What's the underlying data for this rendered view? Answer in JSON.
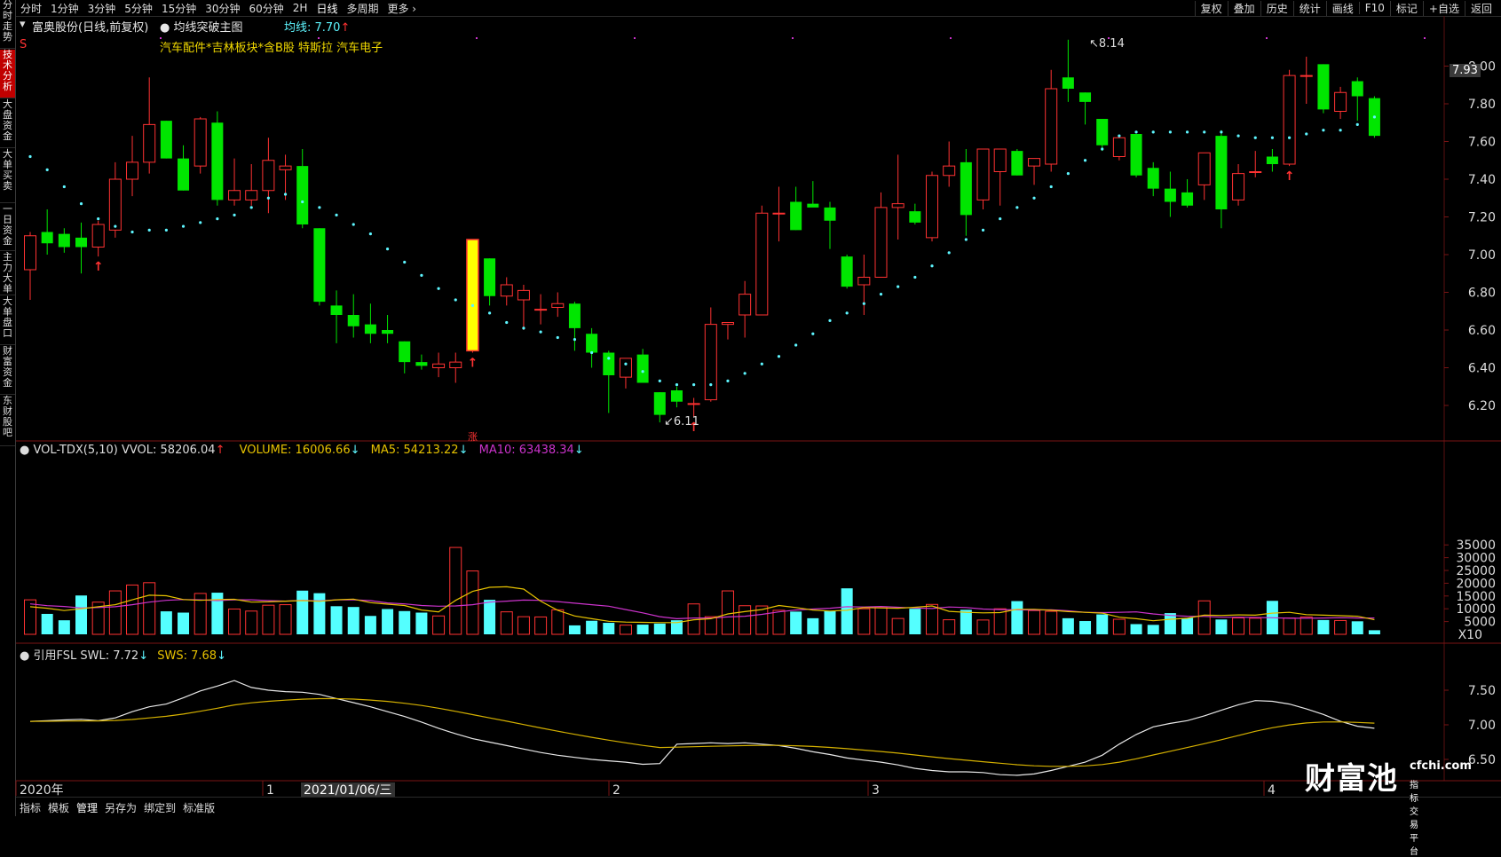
{
  "topbar": {
    "periods": [
      "分时",
      "1分钟",
      "3分钟",
      "5分钟",
      "15分钟",
      "30分钟",
      "60分钟",
      "2H",
      "日线",
      "多周期",
      "更多"
    ],
    "active": "日线",
    "right_tools": [
      "复权",
      "叠加",
      "历史",
      "统计",
      "画线",
      "F10",
      "标记",
      "+自选",
      "返回"
    ]
  },
  "sidebar": [
    {
      "label": "分时走势",
      "active": false
    },
    {
      "label": "技术分析",
      "active": true
    },
    {
      "label": "大盘资金",
      "active": false
    },
    {
      "label": "大单买卖",
      "active": false
    },
    {
      "label": "一日资金",
      "active": false
    },
    {
      "label": "主力大单",
      "active": false
    },
    {
      "label": "大单盘口",
      "active": false
    },
    {
      "label": "财富资金",
      "active": false
    },
    {
      "label": "东财股吧",
      "active": false
    }
  ],
  "header": {
    "stock": "富奥股份(日线,前复权)",
    "template": "均线突破主图",
    "ma_label": "均线: 7.70",
    "ma_arrow": "↑",
    "sectors": "汽车配件*吉林板块*含B股 特斯拉 汽车电子",
    "s_mark": "S"
  },
  "price_panel": {
    "axis_labels": [
      "8.00",
      "7.80",
      "7.60",
      "7.40",
      "7.20",
      "7.00",
      "6.80",
      "6.60",
      "6.40",
      "6.20"
    ],
    "axis_values": [
      8.0,
      7.8,
      7.6,
      7.4,
      7.2,
      7.0,
      6.8,
      6.6,
      6.4,
      6.2
    ],
    "current_price": "7.93",
    "high_note": "8.14",
    "low_note": "6.11",
    "zhang_mark": "涨"
  },
  "volume_panel": {
    "title": "VOL-TDX(5,10)",
    "vvol": "VVOL: 58206.04",
    "volume": "VOLUME: 16006.66",
    "ma5": "MA5: 54213.22",
    "ma10": "MA10: 63438.34",
    "axis_labels": [
      "35000",
      "30000",
      "25000",
      "20000",
      "15000",
      "10000",
      "5000",
      "X10"
    ],
    "axis_values": [
      35000,
      30000,
      25000,
      20000,
      15000,
      10000,
      5000
    ]
  },
  "fsl_panel": {
    "title": "引用FSL",
    "swl": "SWL: 7.72",
    "sws": "SWS: 7.68",
    "axis_labels": [
      "7.50",
      "7.00",
      "6.50"
    ],
    "axis_values": [
      7.5,
      7.0,
      6.5
    ]
  },
  "date_axis": {
    "labels": [
      "2020年",
      "1",
      "2021/01/06/三",
      "2",
      "3",
      "4"
    ]
  },
  "bottombar": {
    "items": [
      "指标",
      "模板",
      "管理",
      "另存为",
      "绑定到",
      "标准版"
    ],
    "active": "管理"
  },
  "watermark": {
    "brand": "财富池",
    "domain": "cfchi.com",
    "slogan": "指标交易平台"
  },
  "colors": {
    "up": "#ff3232",
    "down": "#00e600",
    "vol_down": "#54ffff",
    "ma_dots": "#5ef6ff",
    "ma5": "#e6c200",
    "ma10": "#cc33cc",
    "swl": "#e8e8e8",
    "sws": "#d4b000",
    "highlight": "#ffff00"
  },
  "chart_data": {
    "type": "candlestick",
    "candles": [
      {
        "o": 6.92,
        "h": 7.12,
        "l": 6.76,
        "c": 7.1
      },
      {
        "o": 7.12,
        "h": 7.24,
        "l": 7.0,
        "c": 7.06
      },
      {
        "o": 7.11,
        "h": 7.14,
        "l": 7.01,
        "c": 7.04
      },
      {
        "o": 7.09,
        "h": 7.17,
        "l": 6.9,
        "c": 7.04
      },
      {
        "o": 7.04,
        "h": 7.18,
        "l": 6.99,
        "c": 7.16
      },
      {
        "o": 7.13,
        "h": 7.49,
        "l": 7.09,
        "c": 7.4
      },
      {
        "o": 7.4,
        "h": 7.63,
        "l": 7.31,
        "c": 7.49
      },
      {
        "o": 7.49,
        "h": 7.94,
        "l": 7.43,
        "c": 7.69
      },
      {
        "o": 7.71,
        "h": 7.71,
        "l": 7.51,
        "c": 7.51
      },
      {
        "o": 7.51,
        "h": 7.58,
        "l": 7.34,
        "c": 7.34
      },
      {
        "o": 7.47,
        "h": 7.73,
        "l": 7.43,
        "c": 7.72
      },
      {
        "o": 7.7,
        "h": 7.76,
        "l": 7.26,
        "c": 7.29
      },
      {
        "o": 7.29,
        "h": 7.51,
        "l": 7.26,
        "c": 7.34
      },
      {
        "o": 7.29,
        "h": 7.48,
        "l": 7.26,
        "c": 7.34
      },
      {
        "o": 7.34,
        "h": 7.62,
        "l": 7.22,
        "c": 7.5
      },
      {
        "o": 7.45,
        "h": 7.53,
        "l": 7.29,
        "c": 7.47
      },
      {
        "o": 7.47,
        "h": 7.56,
        "l": 7.14,
        "c": 7.16
      },
      {
        "o": 7.14,
        "h": 7.14,
        "l": 6.73,
        "c": 6.75
      },
      {
        "o": 6.73,
        "h": 6.81,
        "l": 6.53,
        "c": 6.68
      },
      {
        "o": 6.68,
        "h": 6.79,
        "l": 6.56,
        "c": 6.62
      },
      {
        "o": 6.63,
        "h": 6.74,
        "l": 6.53,
        "c": 6.58
      },
      {
        "o": 6.6,
        "h": 6.68,
        "l": 6.53,
        "c": 6.58
      },
      {
        "o": 6.54,
        "h": 6.54,
        "l": 6.37,
        "c": 6.43
      },
      {
        "o": 6.43,
        "h": 6.47,
        "l": 6.39,
        "c": 6.41
      },
      {
        "o": 6.4,
        "h": 6.48,
        "l": 6.35,
        "c": 6.42
      },
      {
        "o": 6.4,
        "h": 6.48,
        "l": 6.32,
        "c": 6.43
      },
      {
        "o": 6.49,
        "h": 7.08,
        "l": 6.48,
        "c": 7.08
      },
      {
        "o": 6.98,
        "h": 6.98,
        "l": 6.73,
        "c": 6.78
      },
      {
        "o": 6.78,
        "h": 6.88,
        "l": 6.73,
        "c": 6.84
      },
      {
        "o": 6.76,
        "h": 6.84,
        "l": 6.6,
        "c": 6.81
      },
      {
        "o": 6.71,
        "h": 6.79,
        "l": 6.63,
        "c": 6.71
      },
      {
        "o": 6.72,
        "h": 6.8,
        "l": 6.67,
        "c": 6.74
      },
      {
        "o": 6.74,
        "h": 6.75,
        "l": 6.49,
        "c": 6.61
      },
      {
        "o": 6.58,
        "h": 6.61,
        "l": 6.4,
        "c": 6.48
      },
      {
        "o": 6.48,
        "h": 6.49,
        "l": 6.16,
        "c": 6.36
      },
      {
        "o": 6.35,
        "h": 6.45,
        "l": 6.29,
        "c": 6.45
      },
      {
        "o": 6.47,
        "h": 6.5,
        "l": 6.32,
        "c": 6.32
      },
      {
        "o": 6.27,
        "h": 6.27,
        "l": 6.11,
        "c": 6.15
      },
      {
        "o": 6.28,
        "h": 6.3,
        "l": 6.19,
        "c": 6.22
      },
      {
        "o": 6.21,
        "h": 6.24,
        "l": 6.14,
        "c": 6.21
      },
      {
        "o": 6.23,
        "h": 6.72,
        "l": 6.22,
        "c": 6.63
      },
      {
        "o": 6.63,
        "h": 6.64,
        "l": 6.55,
        "c": 6.64
      },
      {
        "o": 6.68,
        "h": 6.86,
        "l": 6.56,
        "c": 6.79
      },
      {
        "o": 6.68,
        "h": 7.26,
        "l": 6.68,
        "c": 7.22
      },
      {
        "o": 7.22,
        "h": 7.36,
        "l": 7.07,
        "c": 7.22
      },
      {
        "o": 7.28,
        "h": 7.36,
        "l": 7.13,
        "c": 7.13
      },
      {
        "o": 7.27,
        "h": 7.39,
        "l": 7.26,
        "c": 7.25
      },
      {
        "o": 7.25,
        "h": 7.28,
        "l": 7.03,
        "c": 7.18
      },
      {
        "o": 6.99,
        "h": 7.0,
        "l": 6.82,
        "c": 6.83
      },
      {
        "o": 6.84,
        "h": 7.0,
        "l": 6.68,
        "c": 6.88
      },
      {
        "o": 6.88,
        "h": 7.33,
        "l": 6.88,
        "c": 7.25
      },
      {
        "o": 7.25,
        "h": 7.53,
        "l": 7.08,
        "c": 7.27
      },
      {
        "o": 7.23,
        "h": 7.27,
        "l": 7.16,
        "c": 7.17
      },
      {
        "o": 7.09,
        "h": 7.44,
        "l": 7.07,
        "c": 7.42
      },
      {
        "o": 7.42,
        "h": 7.6,
        "l": 7.36,
        "c": 7.47
      },
      {
        "o": 7.49,
        "h": 7.56,
        "l": 7.1,
        "c": 7.21
      },
      {
        "o": 7.29,
        "h": 7.56,
        "l": 7.24,
        "c": 7.56
      },
      {
        "o": 7.44,
        "h": 7.56,
        "l": 7.26,
        "c": 7.56
      },
      {
        "o": 7.55,
        "h": 7.56,
        "l": 7.42,
        "c": 7.42
      },
      {
        "o": 7.47,
        "h": 7.48,
        "l": 7.37,
        "c": 7.51
      },
      {
        "o": 7.48,
        "h": 7.98,
        "l": 7.44,
        "c": 7.88
      },
      {
        "o": 7.94,
        "h": 8.14,
        "l": 7.81,
        "c": 7.88
      },
      {
        "o": 7.86,
        "h": 7.86,
        "l": 7.69,
        "c": 7.81
      },
      {
        "o": 7.72,
        "h": 7.72,
        "l": 7.55,
        "c": 7.58
      },
      {
        "o": 7.52,
        "h": 7.63,
        "l": 7.5,
        "c": 7.62
      },
      {
        "o": 7.64,
        "h": 7.64,
        "l": 7.41,
        "c": 7.42
      },
      {
        "o": 7.46,
        "h": 7.49,
        "l": 7.31,
        "c": 7.35
      },
      {
        "o": 7.35,
        "h": 7.44,
        "l": 7.2,
        "c": 7.28
      },
      {
        "o": 7.33,
        "h": 7.4,
        "l": 7.25,
        "c": 7.26
      },
      {
        "o": 7.37,
        "h": 7.49,
        "l": 7.29,
        "c": 7.54
      },
      {
        "o": 7.63,
        "h": 7.66,
        "l": 7.14,
        "c": 7.24
      },
      {
        "o": 7.29,
        "h": 7.48,
        "l": 7.26,
        "c": 7.43
      },
      {
        "o": 7.44,
        "h": 7.55,
        "l": 7.41,
        "c": 7.44
      },
      {
        "o": 7.52,
        "h": 7.56,
        "l": 7.44,
        "c": 7.48
      },
      {
        "o": 7.48,
        "h": 7.98,
        "l": 7.47,
        "c": 7.95
      },
      {
        "o": 7.95,
        "h": 8.05,
        "l": 7.8,
        "c": 7.95
      },
      {
        "o": 8.01,
        "h": 8.01,
        "l": 7.75,
        "c": 7.77
      },
      {
        "o": 7.76,
        "h": 7.89,
        "l": 7.72,
        "c": 7.86
      },
      {
        "o": 7.92,
        "h": 7.94,
        "l": 7.71,
        "c": 7.84
      },
      {
        "o": 7.83,
        "h": 7.84,
        "l": 7.62,
        "c": 7.63
      }
    ],
    "ma_dots": [
      7.52,
      7.45,
      7.36,
      7.27,
      7.19,
      7.15,
      7.12,
      7.13,
      7.13,
      7.15,
      7.17,
      7.19,
      7.21,
      7.25,
      7.3,
      7.32,
      7.28,
      7.25,
      7.21,
      7.16,
      7.11,
      7.03,
      6.96,
      6.89,
      6.82,
      6.76,
      6.73,
      6.69,
      6.64,
      6.61,
      6.59,
      6.56,
      6.55,
      6.48,
      6.45,
      6.42,
      6.38,
      6.33,
      6.31,
      6.31,
      6.31,
      6.33,
      6.37,
      6.42,
      6.46,
      6.52,
      6.58,
      6.65,
      6.69,
      6.74,
      6.79,
      6.83,
      6.88,
      6.94,
      7.01,
      7.08,
      7.13,
      7.19,
      7.25,
      7.3,
      7.36,
      7.43,
      7.5,
      7.56,
      7.63,
      7.65,
      7.65,
      7.65,
      7.65,
      7.65,
      7.65,
      7.63,
      7.62,
      7.62,
      7.62,
      7.64,
      7.66,
      7.66,
      7.69,
      7.73
    ],
    "volumes": [
      13500,
      8000,
      5500,
      15200,
      12600,
      17000,
      19300,
      20200,
      9000,
      8500,
      16000,
      16300,
      9900,
      9100,
      11400,
      11600,
      17100,
      16100,
      11000,
      10700,
      7200,
      9900,
      9100,
      8500,
      7200,
      34000,
      24800,
      13500,
      8800,
      6900,
      6800,
      9600,
      3500,
      5300,
      4500,
      3600,
      3800,
      4200,
      5500,
      11900,
      6900,
      17000,
      11200,
      11100,
      9400,
      8900,
      6300,
      9200,
      18000,
      10000,
      10700,
      6200,
      10000,
      11700,
      5700,
      9600,
      5600,
      10000,
      13000,
      9300,
      9000,
      6300,
      5200,
      7800,
      5900,
      4000,
      3700,
      8300,
      6400,
      13100,
      5800,
      6400,
      6300,
      13100,
      6400,
      6800,
      5600,
      5400,
      5100,
      1600
    ],
    "ma5": [
      10800,
      10200,
      9300,
      10000,
      10800,
      11600,
      13500,
      15300,
      15100,
      13600,
      13300,
      13600,
      13700,
      12600,
      12700,
      13000,
      13200,
      12900,
      13500,
      13800,
      12400,
      11800,
      11300,
      9500,
      8800,
      13300,
      16800,
      18400,
      18600,
      17700,
      13000,
      9400,
      7200,
      6100,
      5100,
      4800,
      4700,
      4600,
      4600,
      5700,
      6100,
      8000,
      8900,
      9700,
      11300,
      10500,
      9500,
      9100,
      9400,
      10500,
      10300,
      10200,
      10600,
      11100,
      9000,
      8600,
      8400,
      8500,
      9800,
      9800,
      9400,
      8900,
      8600,
      8300,
      6700,
      6100,
      5300,
      5900,
      6300,
      7500,
      7400,
      7600,
      7500,
      8300,
      8600,
      7700,
      7500,
      7300,
      7100,
      5700
    ],
    "ma10": [
      11900,
      11200,
      10900,
      10300,
      10500,
      10800,
      11600,
      12600,
      13300,
      13600,
      13500,
      13200,
      13500,
      13500,
      13200,
      13000,
      13300,
      13100,
      13500,
      13500,
      13200,
      12300,
      11900,
      11300,
      11000,
      11100,
      11600,
      12600,
      13000,
      13400,
      13300,
      12800,
      12200,
      11600,
      11000,
      9700,
      8400,
      6900,
      6100,
      6400,
      6400,
      6800,
      7100,
      7800,
      8800,
      9500,
      9900,
      10200,
      10800,
      10700,
      10900,
      10600,
      10300,
      10100,
      10700,
      10500,
      9900,
      9700,
      9600,
      9500,
      9600,
      9200,
      8600,
      8500,
      8600,
      8800,
      8000,
      7400,
      7100,
      7000,
      6700,
      6700,
      6600,
      6500,
      6300,
      6300,
      6400,
      6500,
      6400,
      6400
    ],
    "swl": [
      7.05,
      7.06,
      7.07,
      7.08,
      7.06,
      7.1,
      7.19,
      7.26,
      7.3,
      7.39,
      7.49,
      7.56,
      7.64,
      7.54,
      7.5,
      7.48,
      7.47,
      7.44,
      7.38,
      7.32,
      7.26,
      7.19,
      7.12,
      7.04,
      6.95,
      6.87,
      6.8,
      6.75,
      6.7,
      6.65,
      6.6,
      6.56,
      6.53,
      6.5,
      6.48,
      6.46,
      6.43,
      6.44,
      6.72,
      6.73,
      6.74,
      6.73,
      6.74,
      6.72,
      6.7,
      6.66,
      6.61,
      6.57,
      6.52,
      6.49,
      6.46,
      6.42,
      6.37,
      6.34,
      6.32,
      6.32,
      6.31,
      6.28,
      6.27,
      6.29,
      6.34,
      6.4,
      6.46,
      6.56,
      6.72,
      6.86,
      6.97,
      7.02,
      7.06,
      7.13,
      7.21,
      7.29,
      7.35,
      7.34,
      7.3,
      7.23,
      7.15,
      7.05,
      6.98,
      6.95
    ]
  }
}
